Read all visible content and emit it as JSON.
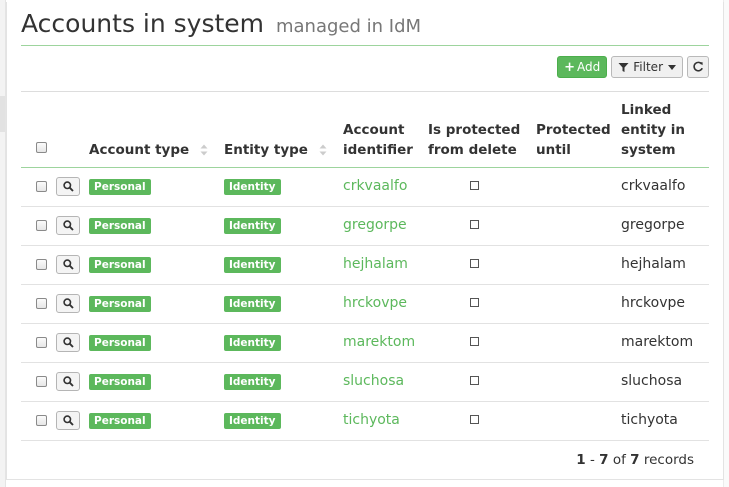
{
  "page": {
    "title": "Accounts in system",
    "subtitle": "managed in IdM"
  },
  "toolbar": {
    "add_label": "Add",
    "filter_label": "Filter"
  },
  "table": {
    "columns": [
      "Account type",
      "Entity type",
      "Account identifier",
      "Is protected from delete",
      "Protected until",
      "Linked entity in system"
    ],
    "header_lines": {
      "account_identifier": [
        "Account",
        "identifier"
      ],
      "is_protected": [
        "Is protected",
        "from delete"
      ],
      "protected_until": [
        "Protected",
        "until"
      ],
      "linked_entity": [
        "Linked",
        "entity in",
        "system"
      ]
    },
    "rows": [
      {
        "account_type": "Personal",
        "entity_type": "Identity",
        "identifier": "crkvaalfo",
        "linked": "crkvaalfo"
      },
      {
        "account_type": "Personal",
        "entity_type": "Identity",
        "identifier": "gregorpe",
        "linked": "gregorpe"
      },
      {
        "account_type": "Personal",
        "entity_type": "Identity",
        "identifier": "hejhalam",
        "linked": "hejhalam"
      },
      {
        "account_type": "Personal",
        "entity_type": "Identity",
        "identifier": "hrckovpe",
        "linked": "hrckovpe"
      },
      {
        "account_type": "Personal",
        "entity_type": "Identity",
        "identifier": "marektom",
        "linked": "marektom"
      },
      {
        "account_type": "Personal",
        "entity_type": "Identity",
        "identifier": "sluchosa",
        "linked": "sluchosa"
      },
      {
        "account_type": "Personal",
        "entity_type": "Identity",
        "identifier": "tichyota",
        "linked": "tichyota"
      }
    ]
  },
  "pagination": {
    "from": "1",
    "separator": " - ",
    "to": "7",
    "of": " of ",
    "total": "7",
    "suffix": " records"
  },
  "colors": {
    "accent": "#5cb85c",
    "text": "#333333",
    "subtitle": "#777777"
  }
}
